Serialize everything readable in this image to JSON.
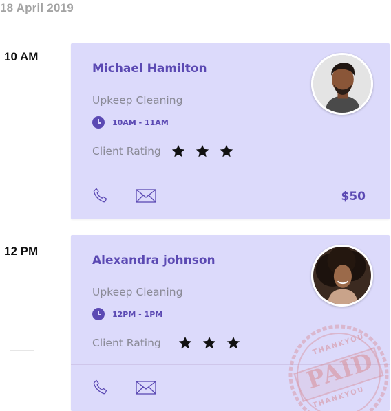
{
  "date": "18 April 2019",
  "appointments": [
    {
      "hour": "10 AM",
      "client_name": "Michael Hamilton",
      "service": "Upkeep Cleaning",
      "time_slot": "10AM - 11AM",
      "rating_label": "Client Rating",
      "rating": 3,
      "price": "$50",
      "paid": false
    },
    {
      "hour": "12 PM",
      "client_name": "Alexandra johnson",
      "service": "Upkeep Cleaning",
      "time_slot": "12PM - 1PM",
      "rating_label": "Client Rating",
      "rating": 3,
      "paid": true
    }
  ],
  "stamp": {
    "top_text": "THANKYOU",
    "main_text": "PAID",
    "bottom_text": "THANKYOU"
  },
  "colors": {
    "card_background": "#dcdafb",
    "accent": "#5b49b3",
    "muted_text": "#8a8a96",
    "date_text": "#a3a3a3",
    "stamp": "#d78c96"
  },
  "icons": {
    "clock": "clock-icon",
    "star": "star-icon",
    "phone": "phone-icon",
    "mail": "mail-icon"
  }
}
